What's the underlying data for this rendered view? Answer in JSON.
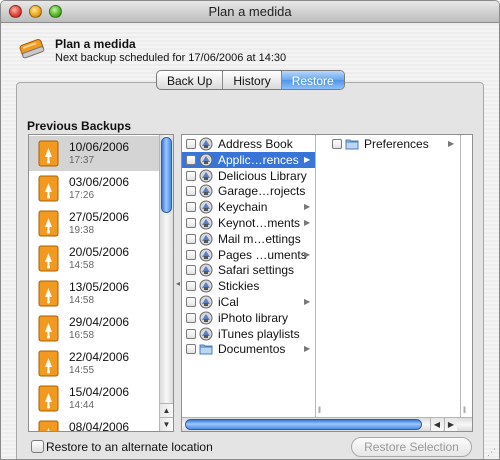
{
  "window": {
    "title": "Plan a medida"
  },
  "header": {
    "app_name": "Plan a medida",
    "schedule": "Next backup scheduled for 17/06/2006 at 14:30",
    "icon": "backup-drive-icon"
  },
  "tabs": [
    {
      "label": "Back Up",
      "active": false
    },
    {
      "label": "History",
      "active": false
    },
    {
      "label": "Restore",
      "active": true
    }
  ],
  "previous_backups": {
    "title": "Previous Backups",
    "icon": "usb-disk-icon",
    "items": [
      {
        "date": "10/06/2006",
        "time": "17:37",
        "selected": true
      },
      {
        "date": "03/06/2006",
        "time": "17:26"
      },
      {
        "date": "27/05/2006",
        "time": "19:38"
      },
      {
        "date": "20/05/2006",
        "time": "14:58"
      },
      {
        "date": "13/05/2006",
        "time": "14:58"
      },
      {
        "date": "29/04/2006",
        "time": "16:58"
      },
      {
        "date": "22/04/2006",
        "time": "14:55"
      },
      {
        "date": "15/04/2006",
        "time": "14:44"
      },
      {
        "date": "08/04/2006",
        "time": ""
      }
    ]
  },
  "browser": {
    "column1": [
      {
        "label": "Address Book",
        "has_children": false
      },
      {
        "label": "Applic…rences",
        "has_children": true,
        "selected": true
      },
      {
        "label": "Delicious Library",
        "has_children": false
      },
      {
        "label": "Garage…rojects",
        "has_children": false
      },
      {
        "label": "Keychain",
        "has_children": true
      },
      {
        "label": "Keynot…ments",
        "has_children": true
      },
      {
        "label": "Mail m…ettings",
        "has_children": false
      },
      {
        "label": "Pages …uments",
        "has_children": true
      },
      {
        "label": "Safari settings",
        "has_children": false
      },
      {
        "label": "Stickies",
        "has_children": false
      },
      {
        "label": "iCal",
        "has_children": true
      },
      {
        "label": "iPhoto library",
        "has_children": false
      },
      {
        "label": "iTunes playlists",
        "has_children": false
      },
      {
        "label": "Documentos",
        "has_children": true,
        "folder": true
      }
    ],
    "column2": [
      {
        "label": "Preferences",
        "has_children": true,
        "folder": true
      }
    ]
  },
  "footer": {
    "alternate_location_label": "Restore to an alternate location",
    "alternate_location_checked": false,
    "restore_button_label": "Restore Selection",
    "restore_button_enabled": false
  },
  "colors": {
    "selection": "#3875d7",
    "tab_active": "#5a9bea",
    "disk_orange": "#f29a1f"
  }
}
